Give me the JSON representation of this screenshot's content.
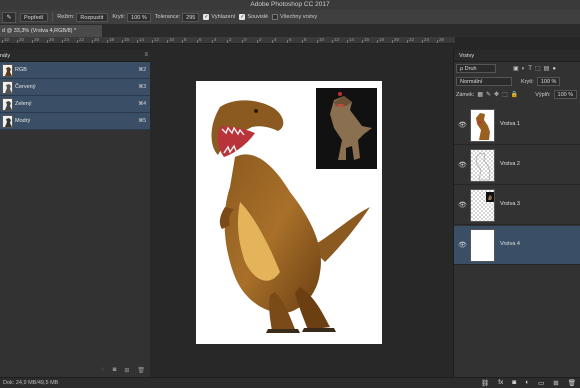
{
  "app": {
    "title": "Adobe Photoshop CC 2017"
  },
  "options_bar": {
    "tool_icon": "brush-icon",
    "preset": "Popředí",
    "mode_label": "Režim:",
    "mode_value": "Rozpustit",
    "opacity_label": "Krytí:",
    "opacity_value": "100 %",
    "tolerance_label": "Tolerance:",
    "tolerance_value": "295",
    "cb1": "Vyhlazení",
    "cb2": "Souvislé",
    "cb3": "Všechny vrstvy"
  },
  "document": {
    "tab_label": "d @ 33,3% (Vrstva 4,RGB/8) *"
  },
  "ruler": {
    "labels": [
      "32",
      "30",
      "28",
      "26",
      "24",
      "22",
      "20",
      "18",
      "16",
      "14",
      "12",
      "10",
      "8",
      "6",
      "4",
      "2",
      "0",
      "2",
      "4",
      "6",
      "8",
      "10",
      "12",
      "14",
      "16",
      "18",
      "20",
      "22",
      "24",
      "26"
    ]
  },
  "channels_panel": {
    "title": "nály",
    "channels": [
      {
        "name": "RGB",
        "shortcut": "⌘2"
      },
      {
        "name": "Červený",
        "shortcut": "⌘3"
      },
      {
        "name": "Zelený",
        "shortcut": "⌘4"
      },
      {
        "name": "Modrý",
        "shortcut": "⌘5"
      }
    ]
  },
  "layers_panel": {
    "title": "Vrstvy",
    "filter_value": "ρ Druh",
    "blend_mode": "Normální",
    "opacity_label": "Krytí:",
    "opacity_value": "100 %",
    "lock_label": "Zámek:",
    "fill_label": "Výplň:",
    "fill_value": "100 %",
    "layers": [
      {
        "name": "Vrstva 1",
        "selected": false
      },
      {
        "name": "Vrstva 2",
        "selected": false
      },
      {
        "name": "Vrstva 3",
        "selected": false
      },
      {
        "name": "Vrstva 4",
        "selected": true
      }
    ]
  },
  "status": {
    "doc_info": "Dok: 24,9 MB/49,5 MB"
  },
  "colors": {
    "accent": "#3a4f66",
    "canvas_bg": "#282828",
    "panel_bg": "#323232"
  }
}
